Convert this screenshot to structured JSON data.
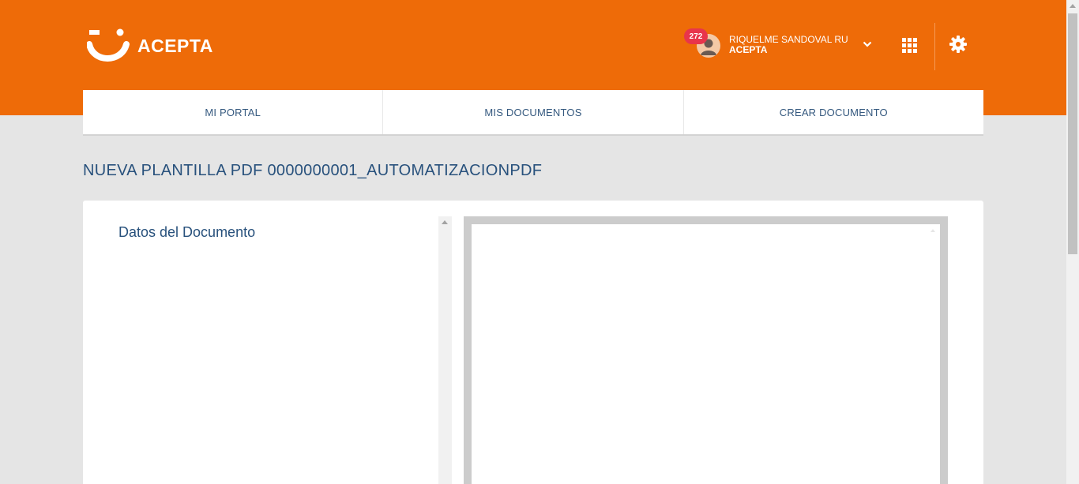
{
  "header": {
    "brand": "ACEPTA",
    "notifications": "272",
    "user_name": "RIQUELME SANDOVAL RU...",
    "user_org": "ACEPTA"
  },
  "nav": {
    "items": [
      {
        "label": "MI PORTAL"
      },
      {
        "label": "MIS DOCUMENTOS"
      },
      {
        "label": "CREAR DOCUMENTO"
      }
    ]
  },
  "page": {
    "title": "NUEVA PLANTILLA PDF 0000000001_AUTOMATIZACIONPDF"
  },
  "form": {
    "section_title": "Datos del Documento"
  },
  "icons": {
    "logo": "acepta-smile-logo",
    "avatar": "user-avatar-icon",
    "dropdown": "chevron-down-icon",
    "apps": "grid-apps-icon",
    "settings": "gear-icon"
  },
  "colors": {
    "brand": "#ee6b08",
    "badge": "#e8354b",
    "text_primary": "#28517c",
    "background": "#e5e5e5"
  }
}
